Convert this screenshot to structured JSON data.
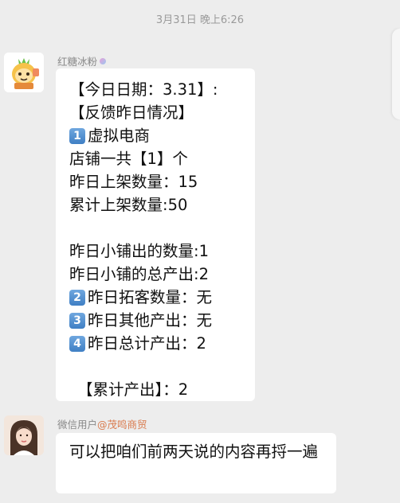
{
  "timestamp": "3月31日 晚上6:26",
  "messages": [
    {
      "sender": "红糖冰粉",
      "lines": [
        {
          "text": "【今日日期：3.31】:",
          "badge": ""
        },
        {
          "text": "【反馈昨日情况】",
          "badge": ""
        },
        {
          "text": "虚拟电商",
          "badge": "1"
        },
        {
          "text": "店铺一共【1】个",
          "badge": ""
        },
        {
          "text": "昨日上架数量：15",
          "badge": ""
        },
        {
          "text": "累计上架数量:50",
          "badge": ""
        },
        {
          "text": "",
          "badge": ""
        },
        {
          "text": "昨日小铺出的数量:1",
          "badge": ""
        },
        {
          "text": "昨日小铺的总产出:2",
          "badge": ""
        },
        {
          "text": "昨日拓客数量：无",
          "badge": "2"
        },
        {
          "text": "昨日其他产出：无",
          "badge": "3"
        },
        {
          "text": "昨日总计产出：2",
          "badge": "4"
        },
        {
          "text": "",
          "badge": ""
        },
        {
          "text": "【累计产出】：2",
          "badge": ""
        }
      ]
    },
    {
      "sender": "微信用户",
      "sender_mention": "@茂鸣商贸",
      "text": "可以把咱们前两天说的内容再捋一遍"
    }
  ],
  "colors": {
    "background": "#ededed",
    "bubble": "#ffffff",
    "badge": "#4a8ad0",
    "mention": "#d97a4d"
  }
}
